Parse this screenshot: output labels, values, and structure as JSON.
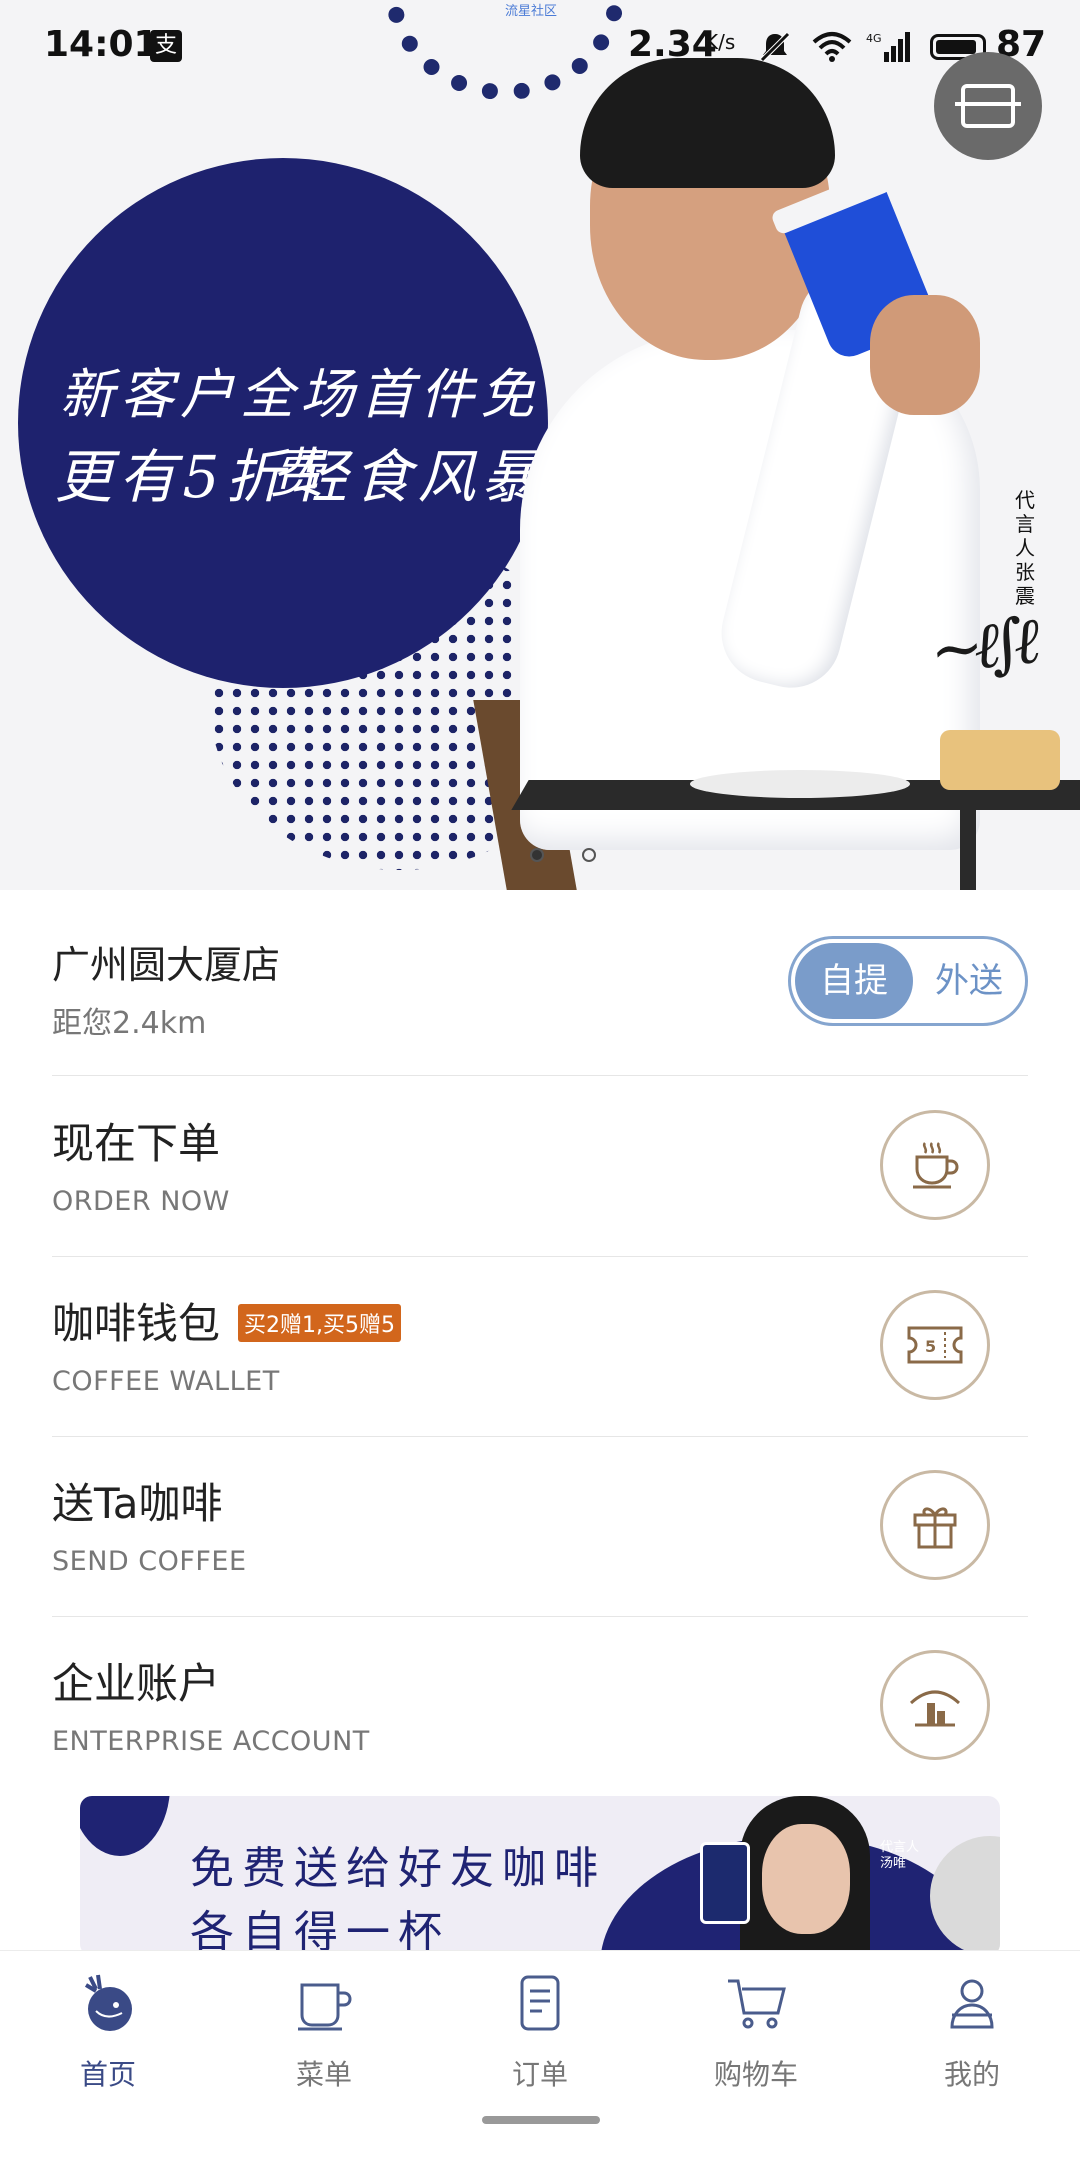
{
  "status_bar": {
    "time": "14:01",
    "alipay_icon": "支",
    "speed": "2.34",
    "speed_unit": "K/s",
    "battery": "87"
  },
  "hero": {
    "ring_text": "流星社区",
    "line1": "新客户全场首件免费",
    "line2": "更有5折轻食风暴",
    "endorse": "代言人张震",
    "signature": "张震",
    "pager_count": 2,
    "pager_active": 0
  },
  "store": {
    "name": "广州圆大厦店",
    "distance": "距您2.4km",
    "toggle_on": "自提",
    "toggle_off": "外送"
  },
  "rows": [
    {
      "title": "现在下单",
      "sub": "ORDER NOW",
      "icon": "coffee-cup-icon"
    },
    {
      "title": "咖啡钱包",
      "sub": "COFFEE WALLET",
      "badge": "买2赠1,买5赠5",
      "icon": "ticket-icon"
    },
    {
      "title": "送Ta咖啡",
      "sub": "SEND COFFEE",
      "icon": "gift-icon"
    },
    {
      "title": "企业账户",
      "sub": "ENTERPRISE ACCOUNT",
      "icon": "building-icon"
    }
  ],
  "promo": {
    "line1": "免费送给好友咖啡",
    "line2": "各自得一杯",
    "endorse": "代言人 汤唯"
  },
  "nav": [
    {
      "label": "首页",
      "icon": "deer-home-icon",
      "active": true
    },
    {
      "label": "菜单",
      "icon": "menu-cup-icon"
    },
    {
      "label": "订单",
      "icon": "order-list-icon"
    },
    {
      "label": "购物车",
      "icon": "cart-icon"
    },
    {
      "label": "我的",
      "icon": "profile-icon"
    }
  ],
  "colors": {
    "brand_navy": "#1e226e",
    "toggle_blue": "#7a9cca",
    "badge_orange": "#d2661c",
    "icon_ring": "#c9b9a4",
    "icon_brown": "#8a6a48"
  }
}
